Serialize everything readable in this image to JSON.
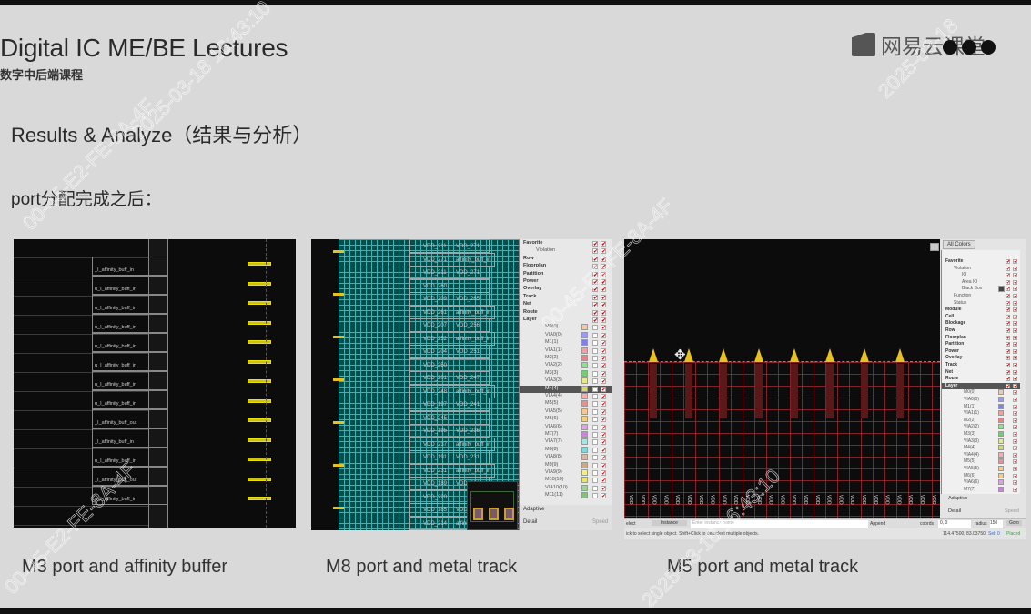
{
  "slide": {
    "title": "Digital IC ME/BE Lectures",
    "subtitle": "数字中后端课程",
    "logo_text": "网易云课堂",
    "heading": "Results & Analyze（结果与分析）",
    "bullet": "port分配完成之后：",
    "captions": [
      "M3 port and affinity buffer",
      "M8 port and metal track",
      "M5 port and metal track"
    ]
  },
  "watermarks": [
    "2025-03-18 16:43:10",
    "2025-03-18",
    "00-45-E2-FE-8A-4F",
    "00-45-E2-FE-8A-4F",
    "2025-03-18 16:43:10",
    "00-45-E2-FE-8A-4F"
  ],
  "panel1": {
    "cell_labels": [
      "_I_affinity_buff_in",
      "u_I_affinity_buff_in",
      "u_I_affinity_buff_in",
      "u_I_affinity_buff_in",
      "u_I_affinity_buff_in",
      "u_I_affinity_buff_in",
      "u_I_affinity_buff_in",
      "u_I_affinity_buff_in",
      "_I_affinity_buff_out",
      "_I_affinity_buff_in",
      "u_I_affinity_buff_in",
      "_I_affinity_buff_out",
      "u_I_affinity_buff_in"
    ]
  },
  "panel2": {
    "cells": [
      [
        "VDD_211",
        "VDD_271"
      ],
      [
        "VDD_271",
        "affinity_buff_in"
      ],
      [
        "VDD_211",
        "VDD_271"
      ],
      [
        "VDD_260",
        ""
      ],
      [
        "VDD_209",
        "VDD_265"
      ],
      [
        "VDD_261",
        "affinity_buff_in"
      ],
      [
        "VDD_207",
        "VDD_256"
      ],
      [
        "VDD_252",
        "affinity_buff_in"
      ],
      [
        "VDD_204",
        "VDD_251"
      ],
      [
        "VDD_250",
        ""
      ],
      [
        "VDD_201",
        "VDD_247"
      ],
      [
        "VDD_248",
        "affinity_buff_in"
      ],
      [
        "VDD_197",
        "VDD_241"
      ],
      [
        "VDD_245",
        ""
      ],
      [
        "VDD_195",
        "VDD_236"
      ],
      [
        "VDD_237",
        "affinity_buff_in"
      ],
      [
        "VDD_191",
        "VDD_231"
      ],
      [
        "VDD_231",
        "affinity_buff_in"
      ],
      [
        "VDD_189",
        "VDD_221"
      ],
      [
        "VDD_220",
        ""
      ],
      [
        "VDD_185",
        "VDD_218"
      ],
      [
        "VDD_214",
        "affinity_buff_in"
      ]
    ],
    "tree": [
      "Favorite",
      "Violation",
      "Row",
      "Floorplan",
      "Partition",
      "Power",
      "Overlay",
      "Track",
      "Net",
      "Route",
      "Layer"
    ],
    "layers": [
      {
        "name": "M0(0)",
        "color": "#f4c9a8"
      },
      {
        "name": "VIA0(0)",
        "color": "#9a9af0"
      },
      {
        "name": "M1(1)",
        "color": "#8080e8"
      },
      {
        "name": "VIA1(1)",
        "color": "#f0a0a0"
      },
      {
        "name": "M2(2)",
        "color": "#f08080"
      },
      {
        "name": "VIA2(2)",
        "color": "#90e090"
      },
      {
        "name": "M3(3)",
        "color": "#70d070"
      },
      {
        "name": "VIA3(3)",
        "color": "#e8e890"
      },
      {
        "name": "M4(4)",
        "color": "#d8d870"
      },
      {
        "name": "VIA4(4)",
        "color": "#f0b0b0"
      },
      {
        "name": "M5(5)",
        "color": "#e89090"
      },
      {
        "name": "VIA5(5)",
        "color": "#f4c890"
      },
      {
        "name": "M6(6)",
        "color": "#f0d080"
      },
      {
        "name": "VIA6(6)",
        "color": "#e0a0e8"
      },
      {
        "name": "M7(7)",
        "color": "#d080e0"
      },
      {
        "name": "VIA7(7)",
        "color": "#a0e8e8"
      },
      {
        "name": "M8(8)",
        "color": "#80d8d8"
      },
      {
        "name": "VIA8(8)",
        "color": "#d8b8a0"
      },
      {
        "name": "M9(9)",
        "color": "#d0a880"
      },
      {
        "name": "VIA9(9)",
        "color": "#f0f080"
      },
      {
        "name": "M10(10)",
        "color": "#e8e860"
      },
      {
        "name": "VIA10(10)",
        "color": "#a0d0a0"
      },
      {
        "name": "M11(11)",
        "color": "#80c080"
      }
    ],
    "selected_layer": "M4(4)",
    "adaptive": "Adaptive",
    "detail": "Detail",
    "speed": "Speed"
  },
  "panel3": {
    "all_colors": "All Colors",
    "tree": [
      {
        "label": "Favorite",
        "level": 0
      },
      {
        "label": "Violation",
        "level": 1
      },
      {
        "label": "IO",
        "level": 2
      },
      {
        "label": "Area IO",
        "level": 2
      },
      {
        "label": "Black Box",
        "level": 2
      },
      {
        "label": "Function",
        "level": 1
      },
      {
        "label": "Status",
        "level": 1
      },
      {
        "label": "Module",
        "level": 0
      },
      {
        "label": "Cell",
        "level": 0
      },
      {
        "label": "Blockage",
        "level": 0
      },
      {
        "label": "Row",
        "level": 0
      },
      {
        "label": "Floorplan",
        "level": 0
      },
      {
        "label": "Partition",
        "level": 0
      },
      {
        "label": "Power",
        "level": 0
      },
      {
        "label": "Overlay",
        "level": 0
      },
      {
        "label": "Track",
        "level": 0
      },
      {
        "label": "Net",
        "level": 0
      },
      {
        "label": "Route",
        "level": 0
      },
      {
        "label": "Layer",
        "level": 0
      }
    ],
    "layers": [
      {
        "name": "M0(0)",
        "color": "#f4c9a8"
      },
      {
        "name": "VIA0(0)",
        "color": "#9a9af0"
      },
      {
        "name": "M1(1)",
        "color": "#8080e8"
      },
      {
        "name": "VIA1(1)",
        "color": "#f0a0a0"
      },
      {
        "name": "M2(2)",
        "color": "#f08080"
      },
      {
        "name": "VIA2(2)",
        "color": "#90e090"
      },
      {
        "name": "M3(3)",
        "color": "#70d070"
      },
      {
        "name": "VIA3(3)",
        "color": "#e8e890"
      },
      {
        "name": "M4(4)",
        "color": "#d8d870"
      },
      {
        "name": "VIA4(4)",
        "color": "#f0b0b0"
      },
      {
        "name": "M5(5)",
        "color": "#e89090"
      },
      {
        "name": "VIA5(5)",
        "color": "#f4c890"
      },
      {
        "name": "M6(6)",
        "color": "#f0d080"
      },
      {
        "name": "VIA6(6)",
        "color": "#e0a0e8"
      },
      {
        "name": "M7(7)",
        "color": "#d080e0"
      }
    ],
    "port_label": "VDD",
    "adaptive": "Adaptive",
    "detail": "Detail",
    "speed": "Speed",
    "toolbar": {
      "select": "elect",
      "instance": "Instance",
      "instance_placeholder": "Enter instance name",
      "append": "Append",
      "coords_label": "coords",
      "coords_value": "0, 0",
      "radius_label": "radius",
      "radius_value": "150",
      "goto": "Goto"
    },
    "status": {
      "hint": "ick to select single object. Shift+Click to de/select multiple objects.",
      "position": "114.47500, 83.03750",
      "sel": "Sel: 0",
      "placed": "Placed"
    }
  }
}
